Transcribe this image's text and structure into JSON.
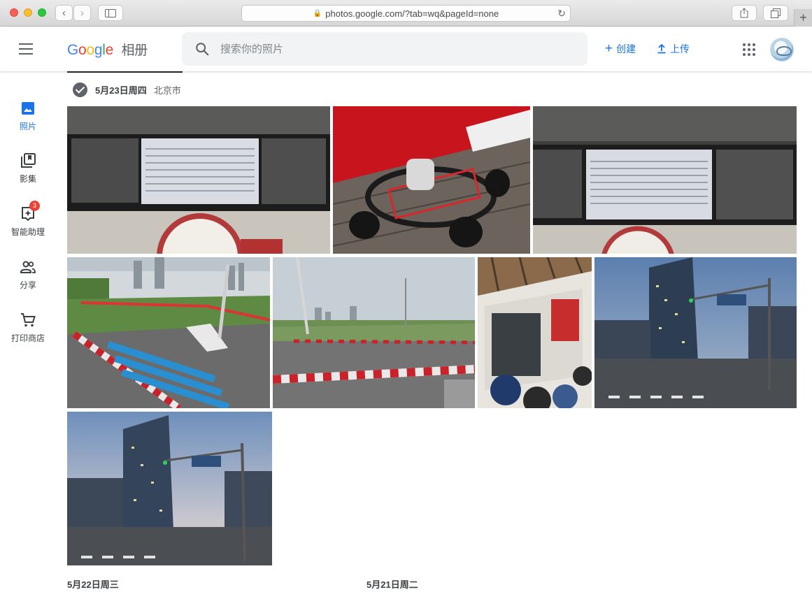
{
  "browser": {
    "url": "photos.google.com/?tab=wq&pageId=none"
  },
  "header": {
    "logo_letters": [
      "G",
      "o",
      "o",
      "g",
      "l",
      "e"
    ],
    "product_name": "相册",
    "search_placeholder": "搜索你的照片",
    "create_label": "创建",
    "upload_label": "上传"
  },
  "sidebar": {
    "items": [
      {
        "label": "照片",
        "icon": "photo-icon",
        "active": true
      },
      {
        "label": "影集",
        "icon": "album-icon",
        "active": false
      },
      {
        "label": "智能助理",
        "icon": "assistant-icon",
        "active": false,
        "badge": "3"
      },
      {
        "label": "分享",
        "icon": "people-icon",
        "active": false
      },
      {
        "label": "打印商店",
        "icon": "cart-icon",
        "active": false
      }
    ]
  },
  "section": {
    "date": "5月23日周四",
    "location": "北京市"
  },
  "footer_dates": [
    "5月22日周三",
    "5月21日周二"
  ],
  "colors": {
    "accent": "#1a73e8",
    "badge": "#ea4335",
    "search_bg": "#f1f3f4"
  }
}
